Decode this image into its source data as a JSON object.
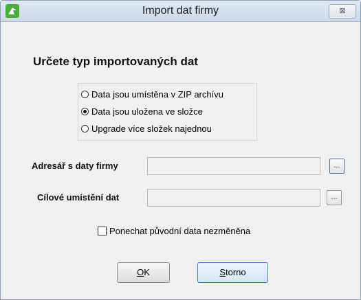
{
  "window": {
    "title": "Import dat firmy",
    "close_label": "⊠"
  },
  "heading": "Určete typ importovaných dat",
  "import_type": {
    "options": [
      {
        "label": "Data jsou umístěna v ZIP archívu",
        "selected": false
      },
      {
        "label": "Data jsou uložena ve složce",
        "selected": true
      },
      {
        "label": "Upgrade více složek najednou",
        "selected": false
      }
    ]
  },
  "fields": {
    "company_dir": {
      "label": "Adresář s daty firmy",
      "value": "",
      "browse_label": "..."
    },
    "target_location": {
      "label": "Cílové umístění dat",
      "value": "",
      "browse_label": "..."
    }
  },
  "keep_original": {
    "label": "Ponechat původní data nezměněna",
    "checked": false
  },
  "buttons": {
    "ok": {
      "mnemonic": "O",
      "rest": "K"
    },
    "cancel": {
      "mnemonic": "S",
      "rest": "torno"
    }
  },
  "icons": {
    "app": "app-logo-icon",
    "close": "close-icon"
  },
  "colors": {
    "app_icon": "#4cae3a",
    "default_button_border": "#3d7bc9"
  }
}
